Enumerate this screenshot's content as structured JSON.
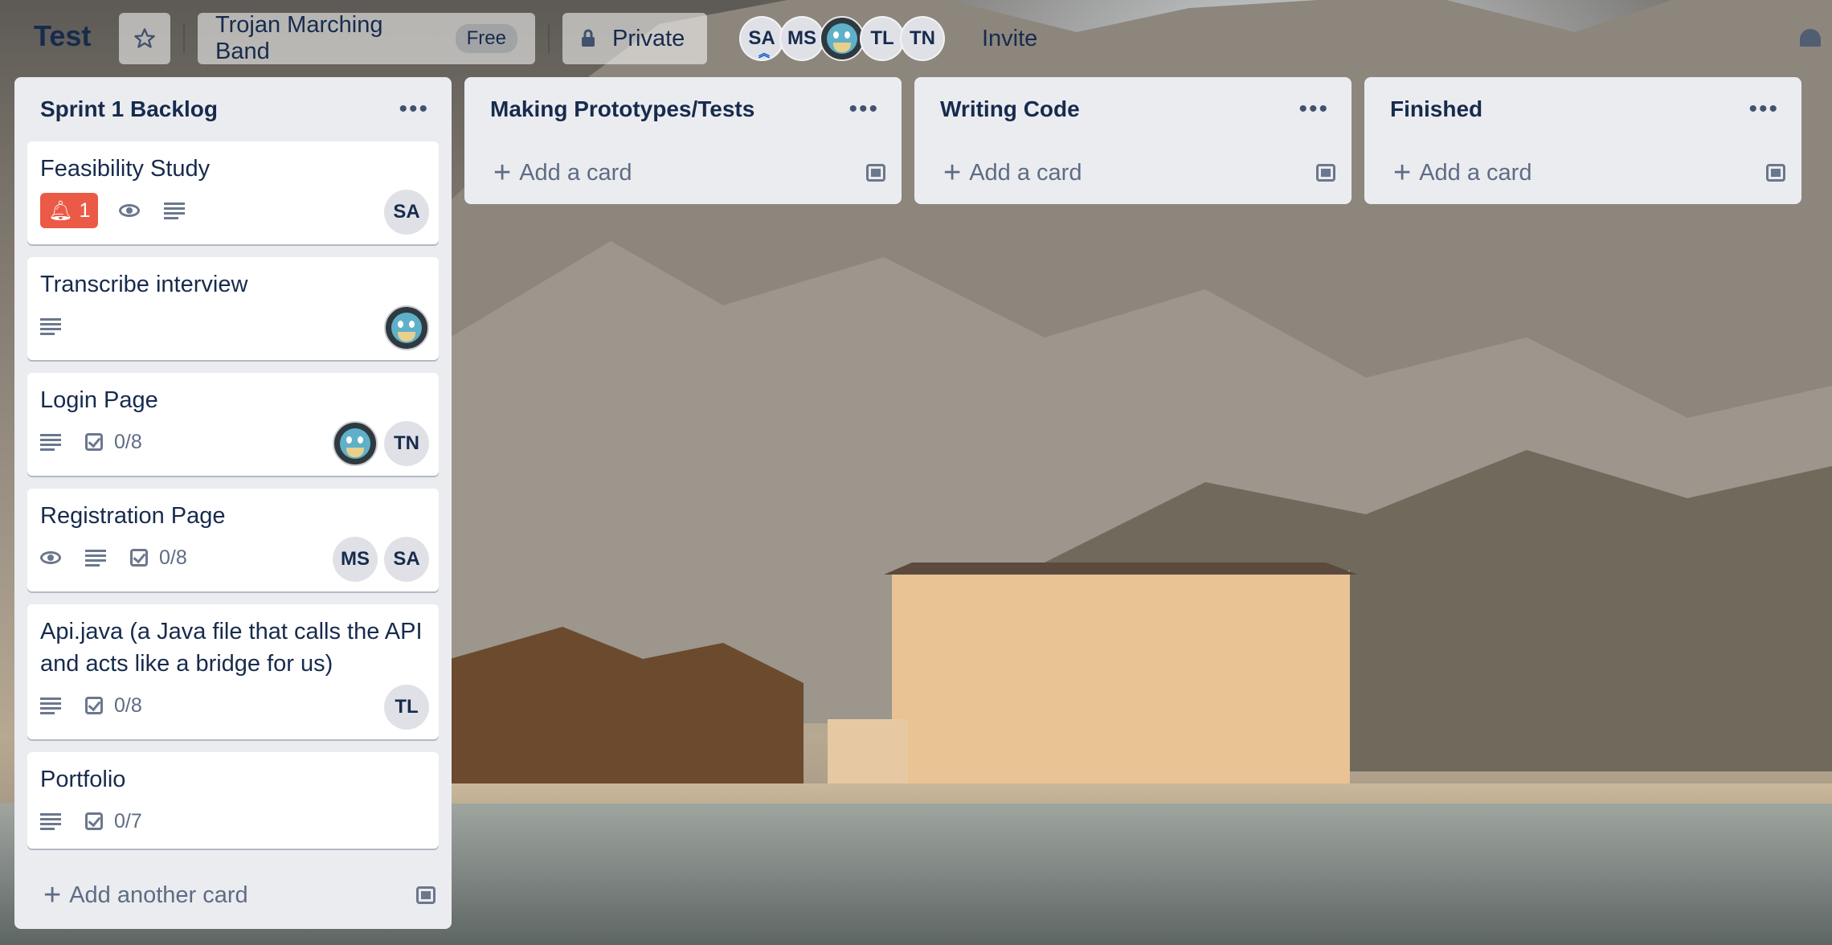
{
  "header": {
    "board_title": "Test",
    "workspace_name": "Trojan Marching Band",
    "workspace_plan": "Free",
    "visibility": "Private",
    "invite_label": "Invite",
    "members": [
      "SA",
      "MS",
      "",
      "TL",
      "TN"
    ]
  },
  "lists": [
    {
      "title": "Sprint 1 Backlog",
      "add_label": "Add another card",
      "cards": [
        {
          "title": "Feasibility Study",
          "alert_count": "1",
          "members": [
            "SA"
          ]
        },
        {
          "title": "Transcribe interview",
          "members": [
            ""
          ]
        },
        {
          "title": "Login Page",
          "checklist": "0/8",
          "members": [
            "",
            "TN"
          ]
        },
        {
          "title": "Registration Page",
          "checklist": "0/8",
          "members": [
            "MS",
            "SA"
          ]
        },
        {
          "title": "Api.java (a Java file that calls the API and acts like a bridge for us)",
          "checklist": "0/8",
          "members": [
            "TL"
          ]
        },
        {
          "title": "Portfolio",
          "checklist": "0/7",
          "members": []
        }
      ]
    },
    {
      "title": "Making Prototypes/Tests",
      "add_label": "Add a card"
    },
    {
      "title": "Writing Code",
      "add_label": "Add a card"
    },
    {
      "title": "Finished",
      "add_label": "Add a card"
    }
  ],
  "colors": {
    "alert": "#eb5a46",
    "list_bg": "#ebecf0",
    "text": "#172b4d"
  },
  "icons": {
    "star": "star-icon",
    "lock": "lock-icon",
    "menu": "more-horizontal-icon",
    "plus": "plus-icon",
    "template": "card-template-icon",
    "bell": "bell-icon",
    "eye": "eye-icon",
    "description": "description-icon",
    "checklist": "checklist-icon"
  }
}
